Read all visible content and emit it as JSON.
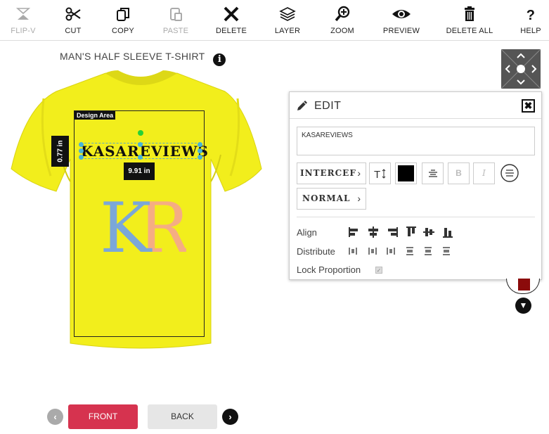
{
  "toolbar": {
    "items": [
      {
        "label": "FLIP-V",
        "icon": "flip-vertical-icon",
        "disabled": true
      },
      {
        "label": "CUT",
        "icon": "scissors-icon",
        "disabled": false
      },
      {
        "label": "COPY",
        "icon": "copy-icon",
        "disabled": false
      },
      {
        "label": "PASTE",
        "icon": "paste-icon",
        "disabled": true
      },
      {
        "label": "DELETE",
        "icon": "x-icon",
        "disabled": false
      },
      {
        "label": "LAYER",
        "icon": "layers-icon",
        "disabled": false
      },
      {
        "label": "ZOOM",
        "icon": "zoom-in-icon",
        "disabled": false
      },
      {
        "label": "PREVIEW",
        "icon": "eye-icon",
        "disabled": false
      },
      {
        "label": "DELETE ALL",
        "icon": "trash-icon",
        "disabled": false
      },
      {
        "label": "HELP",
        "icon": "question-icon",
        "disabled": false
      }
    ]
  },
  "product": {
    "title": "MAN'S HALF SLEEVE T-SHIRT",
    "shirt_color": "#f2ee1c"
  },
  "canvas": {
    "design_area_label": "Design Area",
    "height_readout": "0.77 in",
    "width_readout": "9.91 in",
    "text_object": "KASAREVIEWS",
    "logo_letters": {
      "left": "K",
      "right": "R"
    },
    "logo_colors": {
      "left": "#7ba7d8",
      "right": "#f5ad83"
    }
  },
  "edit_panel": {
    "title": "EDIT",
    "close_label": "✖",
    "text_value": "KASAREVIEWS",
    "font_name": "INTERCEF",
    "text_color": "#000000",
    "style_name": "NORMAL",
    "align_label": "Align",
    "distribute_label": "Distribute",
    "lock_label": "Lock Proportion",
    "lock_checked": true
  },
  "side_color": "#8b0b0b",
  "sides": {
    "front_label": "FRONT",
    "back_label": "BACK"
  },
  "colors": {
    "accent": "#d6334f",
    "toolbar_text": "#222222"
  }
}
